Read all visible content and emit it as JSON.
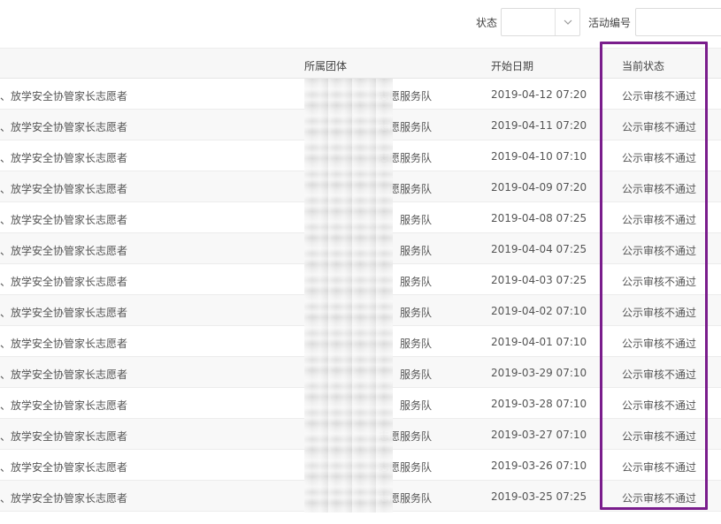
{
  "filters": {
    "status_label": "状态",
    "status_value": "",
    "activity_label": "活动编号",
    "activity_value": ""
  },
  "table": {
    "headers": {
      "group": "所属团体",
      "start_date": "开始日期",
      "current_status": "当前状态"
    },
    "rows": [
      {
        "name": "、放学安全协管家长志愿者",
        "group": "志愿服务队",
        "start_date": "2019-04-12 07:20",
        "status": "公示审核不通过"
      },
      {
        "name": "、放学安全协管家长志愿者",
        "group": "志愿服务队",
        "start_date": "2019-04-11 07:20",
        "status": "公示审核不通过"
      },
      {
        "name": "、放学安全协管家长志愿者",
        "group": "志愿服务队",
        "start_date": "2019-04-10 07:10",
        "status": "公示审核不通过"
      },
      {
        "name": "、放学安全协管家长志愿者",
        "group": "愿服务队",
        "start_date": "2019-04-09 07:20",
        "status": "公示审核不通过"
      },
      {
        "name": "、放学安全协管家长志愿者",
        "group": "服务队",
        "start_date": "2019-04-08 07:25",
        "status": "公示审核不通过"
      },
      {
        "name": "、放学安全协管家长志愿者",
        "group": "服务队",
        "start_date": "2019-04-04 07:25",
        "status": "公示审核不通过"
      },
      {
        "name": "、放学安全协管家长志愿者",
        "group": "服务队",
        "start_date": "2019-04-03 07:25",
        "status": "公示审核不通过"
      },
      {
        "name": "、放学安全协管家长志愿者",
        "group": "服务队",
        "start_date": "2019-04-02 07:10",
        "status": "公示审核不通过"
      },
      {
        "name": "、放学安全协管家长志愿者",
        "group": "服务队",
        "start_date": "2019-04-01 07:10",
        "status": "公示审核不通过"
      },
      {
        "name": "、放学安全协管家长志愿者",
        "group": "服务队",
        "start_date": "2019-03-29 07:10",
        "status": "公示审核不通过"
      },
      {
        "name": "、放学安全协管家长志愿者",
        "group": "服务队",
        "start_date": "2019-03-28 07:10",
        "status": "公示审核不通过"
      },
      {
        "name": "、放学安全协管家长志愿者",
        "group": "志愿服务队",
        "start_date": "2019-03-27 07:10",
        "status": "公示审核不通过"
      },
      {
        "name": "、放学安全协管家长志愿者",
        "group": "志愿服务队",
        "start_date": "2019-03-26 07:10",
        "status": "公示审核不通过"
      },
      {
        "name": "、放学安全协管家长志愿者",
        "group": "志愿服务队",
        "start_date": "2019-03-25 07:25",
        "status": "公示审核不通过"
      }
    ]
  },
  "colors": {
    "highlight": "#7a1d8c"
  },
  "icons": {
    "select_arrow": "chevron-down-icon"
  }
}
